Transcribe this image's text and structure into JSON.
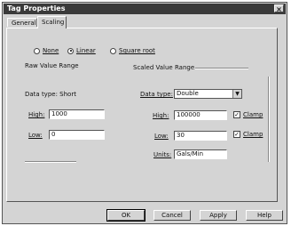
{
  "window": {
    "title": "Tag Properties",
    "close_glyph": "×"
  },
  "tabs": [
    {
      "label": "General",
      "active": false
    },
    {
      "label": "Scaling",
      "active": true
    }
  ],
  "scaling_mode": {
    "options": [
      {
        "label": "None",
        "selected": false
      },
      {
        "label": "Linear",
        "selected": true
      },
      {
        "label": "Square root",
        "selected": false
      }
    ]
  },
  "raw": {
    "group_label": "Raw Value Range",
    "data_type_text": "Data type:  Short",
    "high_label": "High:",
    "high_value": "1000",
    "low_label": "Low:",
    "low_value": "0"
  },
  "scaled": {
    "group_label": "Scaled Value Range",
    "data_type_label": "Data type:",
    "data_type_value": "Double",
    "high_label": "High:",
    "high_value": "100000",
    "low_label": "Low:",
    "low_value": "30",
    "units_label": "Units:",
    "units_value": "Gals/Min",
    "clamp_high_label": "Clamp",
    "clamp_high_checked": true,
    "clamp_low_label": "Clamp",
    "clamp_low_checked": true
  },
  "buttons": {
    "ok": "OK",
    "cancel": "Cancel",
    "apply": "Apply",
    "help": "Help"
  }
}
